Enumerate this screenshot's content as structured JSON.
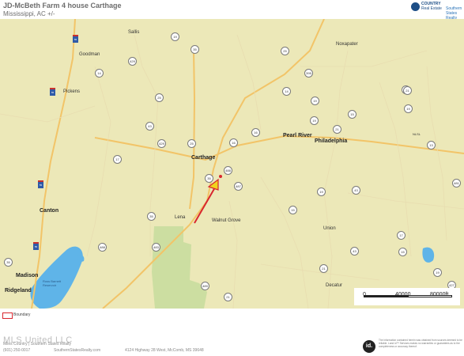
{
  "header": {
    "title": "JD-McBeth Farm 4 house Carthage",
    "subtitle": "Mississippi, AC +/-",
    "logo_line1": "COUNTRY",
    "logo_line2": "Real Estate",
    "logo_line3": "Southern",
    "logo_line4": "States Realty"
  },
  "map": {
    "cities": [
      {
        "id": "sallis",
        "name": "Sallis"
      },
      {
        "id": "goodman",
        "name": "Goodman"
      },
      {
        "id": "noxapater",
        "name": "Noxapater"
      },
      {
        "id": "pickens",
        "name": "Pickens"
      },
      {
        "id": "pearl-river",
        "name": "Pearl River"
      },
      {
        "id": "philadelphia",
        "name": "Philadelphia"
      },
      {
        "id": "carthage",
        "name": "Carthage"
      },
      {
        "id": "canton",
        "name": "Canton"
      },
      {
        "id": "lena",
        "name": "Lena"
      },
      {
        "id": "walnut-grove",
        "name": "Walnut Grove"
      },
      {
        "id": "union",
        "name": "Union"
      },
      {
        "id": "madison",
        "name": "Madison"
      },
      {
        "id": "ridgeland",
        "name": "Ridgeland"
      },
      {
        "id": "decatur",
        "name": "Decatur"
      },
      {
        "id": "ross-barnett",
        "name": "Ross Barnett Reservoir"
      },
      {
        "id": "nlsl",
        "name": "NLSL"
      }
    ],
    "route_numbers": [
      "19",
      "35",
      "25",
      "429",
      "14",
      "395",
      "14",
      "19",
      "25",
      "12",
      "17",
      "43",
      "16",
      "19",
      "429",
      "25",
      "35",
      "488",
      "487",
      "15",
      "16",
      "21",
      "35",
      "19",
      "43",
      "481",
      "13",
      "35",
      "483",
      "21",
      "21",
      "15",
      "488",
      "21",
      "43",
      "427",
      "17",
      "19",
      "15",
      "489",
      "19"
    ],
    "interstate_numbers": [
      "55",
      "55",
      "55",
      "55"
    ],
    "scale": {
      "mid": "40000",
      "end": "80000ft",
      "start": "0"
    }
  },
  "legend": {
    "label": "Boundary"
  },
  "footer": {
    "watermark": "MLS United LLC",
    "brokerage": "Miles Country | Southern States Realty",
    "phone": "(601) 250-0017",
    "website": "SouthernStatesRealty.com",
    "address": "4124 Highway 28 West, McComb, MS 39648",
    "id_logo": "id.",
    "disclaimer": "The information contained herein was obtained from sources deemed to be reliable. Land id™ Services makes no warranties or guarantees as to the completeness or accuracy thereof."
  },
  "colors": {
    "land": "#ece8b8",
    "water": "#5fb4e8",
    "forest": "#c6dd9b",
    "road": "#f2c468",
    "arrow": "#d8262e",
    "marker": "#f0d31d"
  }
}
